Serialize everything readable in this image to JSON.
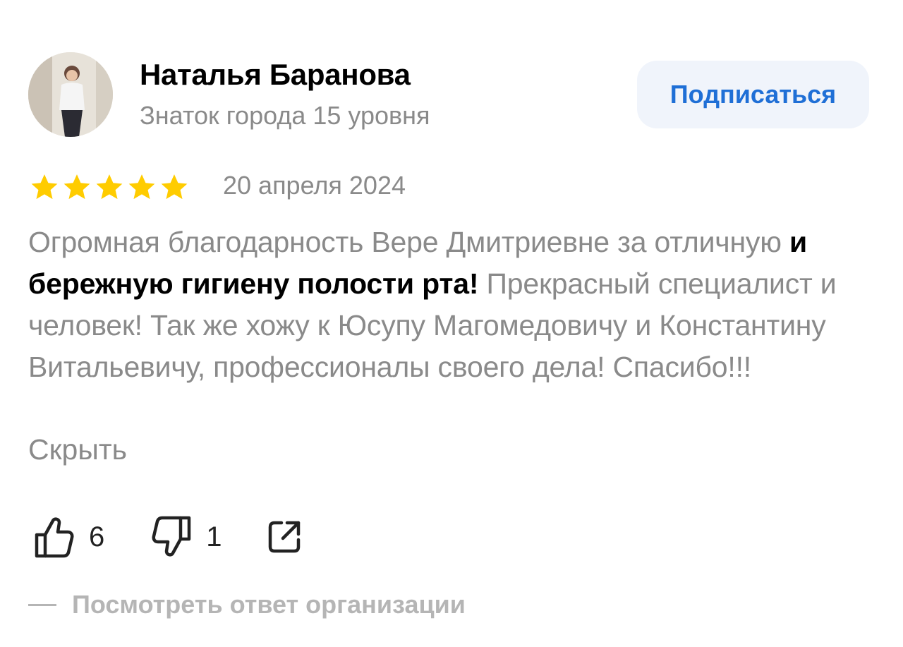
{
  "author": {
    "name": "Наталья Баранова",
    "level": "Знаток города 15 уровня"
  },
  "subscribe_label": "Подписаться",
  "review": {
    "rating": 5,
    "rating_max": 5,
    "star_color": "#ffcc00",
    "date": "20 апреля 2024",
    "text_part1": "Огромная благодарность Вере Дмитриевне за отличную ",
    "text_bold": "и бережную гигиену полости рта!",
    "text_part2": " Прекрасный специалист и человек! Так же хожу к Юсупу Магомедовичу и Константину Витальевичу, профессионалы своего дела! Спасибо!!!",
    "hide_label": "Скрыть"
  },
  "actions": {
    "likes": "6",
    "dislikes": "1",
    "like_icon": "thumbs-up-icon",
    "dislike_icon": "thumbs-down-icon",
    "share_icon": "share-icon"
  },
  "org_reply_label": "Посмотреть ответ организации",
  "colors": {
    "accent": "#1f6fd6",
    "button_bg": "#f0f4fb",
    "muted_text": "#8a8a8a",
    "light_text": "#b5b5b5"
  }
}
